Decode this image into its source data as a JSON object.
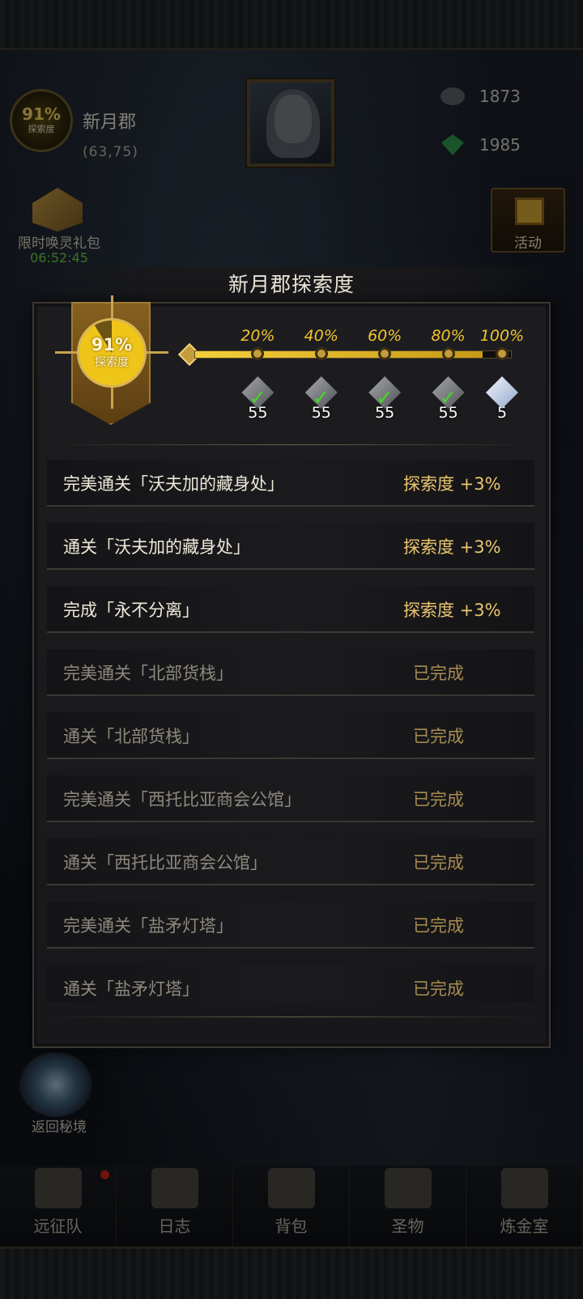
{
  "hud": {
    "explore_percent": "91%",
    "explore_label": "探索度",
    "region_name": "新月郡",
    "region_coord": "(63,75)",
    "resource_1": "1873",
    "resource_2": "1985",
    "gift_label": "限时唤灵礼包",
    "gift_timer": "06:52:45",
    "activity_label": "活动",
    "portal_label": "返回秘境"
  },
  "nav": {
    "items": [
      {
        "label": "远征队",
        "icon": "helmet-icon"
      },
      {
        "label": "日志",
        "icon": "scroll-icon"
      },
      {
        "label": "背包",
        "icon": "bag-icon"
      },
      {
        "label": "圣物",
        "icon": "relic-icon"
      },
      {
        "label": "炼金室",
        "icon": "alchemy-icon"
      }
    ]
  },
  "panel": {
    "title": "新月郡探索度",
    "progress_percent": "91%",
    "progress_label": "探索度",
    "progress_value": 0.91,
    "milestones": [
      {
        "label": "20%",
        "reward_count": "55",
        "claimed": true,
        "icon": "ore-icon"
      },
      {
        "label": "40%",
        "reward_count": "55",
        "claimed": true,
        "icon": "ore-icon"
      },
      {
        "label": "60%",
        "reward_count": "55",
        "claimed": true,
        "icon": "ore-icon"
      },
      {
        "label": "80%",
        "reward_count": "55",
        "claimed": true,
        "icon": "ore-icon"
      },
      {
        "label": "100%",
        "reward_count": "5",
        "claimed": false,
        "icon": "crystal-icon"
      }
    ],
    "tasks": [
      {
        "task": "完美通关「沃夫加的藏身处」",
        "reward": "探索度 +3%",
        "done": false
      },
      {
        "task": "通关「沃夫加的藏身处」",
        "reward": "探索度 +3%",
        "done": false
      },
      {
        "task": "完成「永不分离」",
        "reward": "探索度 +3%",
        "done": false
      },
      {
        "task": "完美通关「北部货栈」",
        "reward": "已完成",
        "done": true
      },
      {
        "task": "通关「北部货栈」",
        "reward": "已完成",
        "done": true
      },
      {
        "task": "完美通关「西托比亚商会公馆」",
        "reward": "已完成",
        "done": true
      },
      {
        "task": "通关「西托比亚商会公馆」",
        "reward": "已完成",
        "done": true
      },
      {
        "task": "完美通关「盐矛灯塔」",
        "reward": "已完成",
        "done": true
      },
      {
        "task": "通关「盐矛灯塔」",
        "reward": "已完成",
        "done": true
      }
    ]
  },
  "colors": {
    "gold": "#f2c42e",
    "done_text": "#a88c52",
    "check": "#46d42b"
  }
}
